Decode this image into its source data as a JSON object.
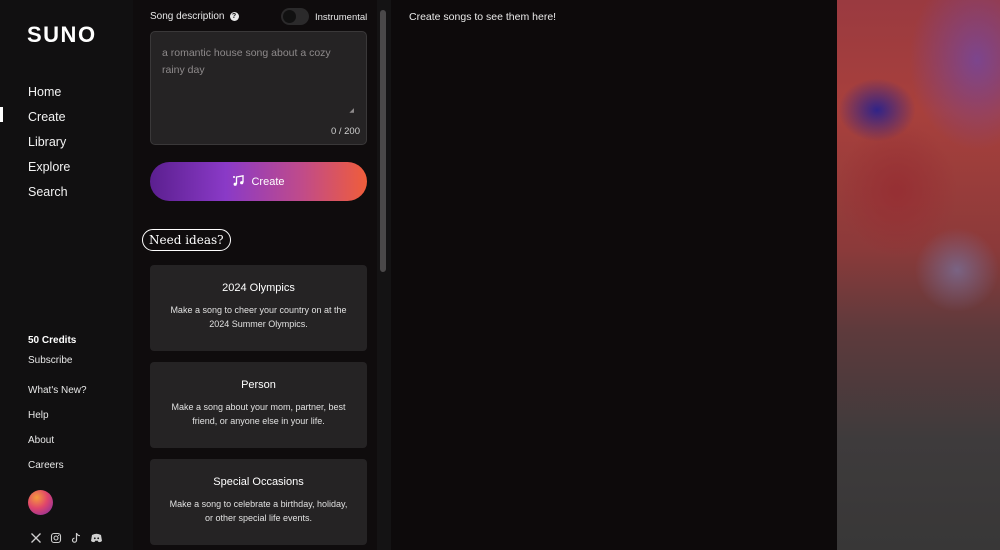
{
  "brand": {
    "logo": "SUNO"
  },
  "nav": {
    "items": [
      {
        "label": "Home"
      },
      {
        "label": "Create",
        "active": true
      },
      {
        "label": "Library"
      },
      {
        "label": "Explore"
      },
      {
        "label": "Search"
      }
    ]
  },
  "account": {
    "credits": "50 Credits",
    "subscribe": "Subscribe"
  },
  "footer_links": {
    "whats_new": "What's New?",
    "help": "Help",
    "about": "About",
    "careers": "Careers"
  },
  "socials": [
    "x-icon",
    "instagram-icon",
    "tiktok-icon",
    "discord-icon"
  ],
  "form": {
    "description_label": "Song description",
    "instrumental_label": "Instrumental",
    "instrumental_on": false,
    "placeholder": "a romantic house song about a cozy rainy day",
    "counter": "0 / 200",
    "create_label": "Create"
  },
  "ideas": {
    "title": "Need ideas?",
    "cards": [
      {
        "title": "2024 Olympics",
        "desc": "Make a song to cheer your country on at the 2024 Summer Olympics."
      },
      {
        "title": "Person",
        "desc": "Make a song about your mom, partner, best friend, or anyone else in your life."
      },
      {
        "title": "Special Occasions",
        "desc": "Make a song to celebrate a birthday, holiday, or other special life events."
      }
    ]
  },
  "main": {
    "empty_message": "Create songs to see them here!"
  },
  "colors": {
    "background": "#0d0a0b",
    "card": "#252324",
    "button_gradient": [
      "#5b1f8f",
      "#8a3ac7",
      "#c04b8a",
      "#f05d3a"
    ]
  }
}
